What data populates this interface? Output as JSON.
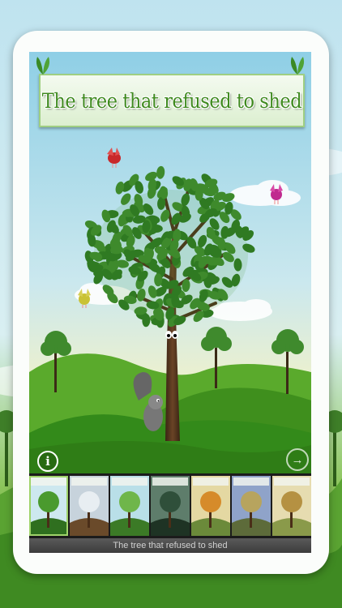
{
  "story": {
    "title": "The tree that refused to shed"
  },
  "controls": {
    "info_label": "i",
    "next_label": "→"
  },
  "thumbnails": {
    "caption": "The tree that refused to shed",
    "pages": [
      {
        "scene": "cover",
        "selected": true
      },
      {
        "scene": "winter",
        "selected": false
      },
      {
        "scene": "spring",
        "selected": false
      },
      {
        "scene": "storm",
        "selected": false
      },
      {
        "scene": "autumn-picnic",
        "selected": false
      },
      {
        "scene": "dusk",
        "selected": false
      },
      {
        "scene": "meadow",
        "selected": false
      }
    ]
  },
  "colors": {
    "title_green": "#3f8a1f",
    "leaf_green": "#3e8a2c",
    "sky_top": "#8fcfe6",
    "hill_green": "#4d9a24"
  }
}
